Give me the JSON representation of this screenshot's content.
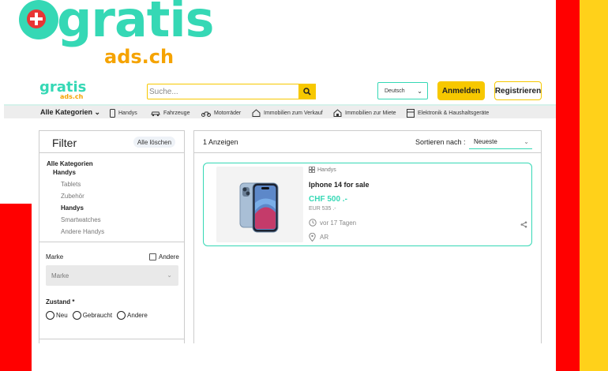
{
  "branding": {
    "logo_main": "gratis",
    "logo_sub": "ads.ch",
    "brand_color": "#35d8b5",
    "accent_color": "#f7c800",
    "logo_sub_color": "#f5a300"
  },
  "header": {
    "search_placeholder": "Suche...",
    "language": "Deutsch",
    "login_label": "Anmelden",
    "register_label": "Registrieren"
  },
  "categories": {
    "all_label": "Alle Kategorien",
    "items": [
      {
        "label": "Handys",
        "icon": "phone-icon"
      },
      {
        "label": "Fahrzeuge",
        "icon": "car-icon"
      },
      {
        "label": "Motorräder",
        "icon": "motorcycle-icon"
      },
      {
        "label": "Immobilien zum Verkauf",
        "icon": "house-icon"
      },
      {
        "label": "Immobilien zur Miete",
        "icon": "house-rent-icon"
      },
      {
        "label": "Elektronik & Haushaltsgeräte",
        "icon": "appliance-icon"
      }
    ]
  },
  "filter": {
    "title": "Filter",
    "clear_label": "Alle löschen",
    "tree": {
      "root": "Alle Kategorien",
      "current": "Handys",
      "children": [
        "Tablets",
        "Zubehör",
        "Handys",
        "Smartwatches",
        "Andere Handys"
      ],
      "selected_child": "Handys"
    },
    "brand": {
      "label": "Marke",
      "other_label": "Andere",
      "select_placeholder": "Marke"
    },
    "condition": {
      "label": "Zustand *",
      "options": [
        "Neu",
        "Gebraucht",
        "Andere"
      ]
    }
  },
  "results": {
    "count_label": "1 Anzeigen",
    "sort_label": "Sortieren nach :",
    "sort_value": "Neueste",
    "listings": [
      {
        "category": "Handys",
        "title": "Iphone 14 for sale",
        "price": "CHF 500 .-",
        "price_eur": "EUR 535 .-",
        "posted": "vor 17 Tagen",
        "location": "AR"
      }
    ]
  },
  "decor": {
    "red": "#ff0000",
    "yellow": "#ffd11a"
  }
}
